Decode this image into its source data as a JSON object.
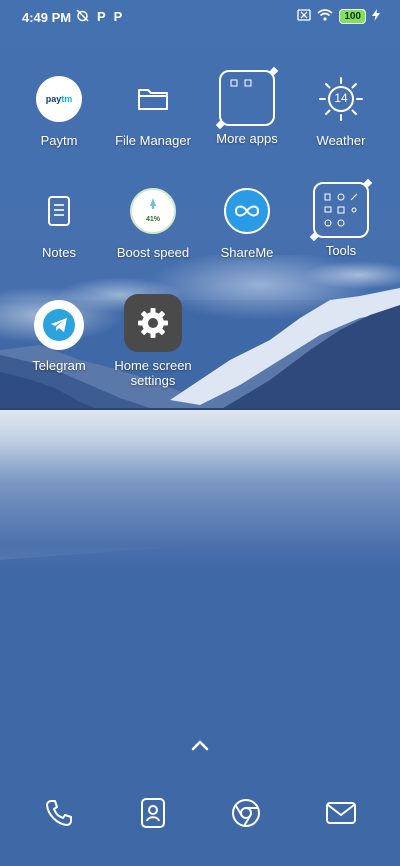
{
  "status_bar": {
    "time": "4:49 PM",
    "notif_icons": [
      "no-alarm-icon",
      "paytm-p-icon",
      "paytm-p-icon"
    ],
    "battery_level": "100",
    "right_icons": [
      "sim-off-icon",
      "wifi-icon",
      "battery-icon",
      "charging-icon"
    ]
  },
  "apps": [
    {
      "name": "paytm",
      "label": "Paytm",
      "icon_text": "pay",
      "icon_text_accent": "tm"
    },
    {
      "name": "file-manager",
      "label": "File Manager"
    },
    {
      "name": "more-apps",
      "label": "More apps"
    },
    {
      "name": "weather",
      "label": "Weather",
      "temp": "14"
    },
    {
      "name": "notes",
      "label": "Notes"
    },
    {
      "name": "boost-speed",
      "label": "Boost speed",
      "percent": "41%"
    },
    {
      "name": "shareme",
      "label": "ShareMe"
    },
    {
      "name": "tools",
      "label": "Tools"
    },
    {
      "name": "telegram",
      "label": "Telegram"
    },
    {
      "name": "home-screen-settings",
      "label": "Home screen settings"
    }
  ],
  "dock": [
    "phone-icon",
    "contacts-icon",
    "browser-icon",
    "messaging-icon"
  ],
  "colors": {
    "wallpaper_blue": "#3f68a6",
    "battery_green": "#7ee25d",
    "shareme_blue": "#2b9be6",
    "settings_gray": "#4a4a4a"
  }
}
